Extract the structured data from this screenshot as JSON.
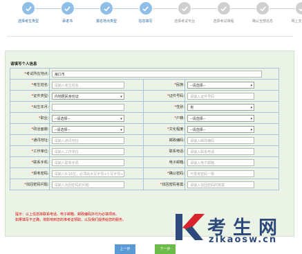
{
  "steps": [
    {
      "label": "选择考生类型",
      "state": "done"
    },
    {
      "label": "承诺书",
      "state": "done"
    },
    {
      "label": "报名地点类型",
      "state": "done"
    },
    {
      "label": "信息填写",
      "state": "done"
    },
    {
      "label": "选择考试专业",
      "state": "todo"
    },
    {
      "label": "选择考试课程",
      "state": "todo"
    },
    {
      "label": "确认全部信息",
      "state": "todo"
    },
    {
      "label": "网上支付费用",
      "state": "todo"
    }
  ],
  "form": {
    "title": "请填写个人信息",
    "exam_location": {
      "label": "*考试所在地点:",
      "value": "海口市"
    },
    "rows": [
      {
        "l1": "*考生姓名:",
        "t1": "input",
        "v1": "请输入考生姓名",
        "l2": "*民族:",
        "t2": "select",
        "v2": "--请选择--"
      },
      {
        "l1": "*证件类型:",
        "t1": "select",
        "v1": "内地居民身份证",
        "l2": "*证件号码:",
        "t2": "input",
        "v2": "请输入证件号码"
      },
      {
        "l1": "*出生年月:",
        "t1": "input",
        "v1": "",
        "l2": "*性别:",
        "t2": "select",
        "v2": "男"
      },
      {
        "l1": "*职业:",
        "t1": "select",
        "v1": "--请选择--",
        "l2": "*户籍:",
        "t2": "select",
        "v2": "--请选择--"
      },
      {
        "l1": "*政治面貌:",
        "t1": "select",
        "v1": "--请选择--",
        "l2": "*文化程度:",
        "t2": "select",
        "v2": "--请选择--"
      },
      {
        "l1": "*通讯地址:",
        "t1": "input",
        "v1": "请输入通讯地址",
        "l2": "邮政编码:",
        "t2": "input",
        "v2": "请输入邮政编码"
      },
      {
        "l1": "*工作单位:",
        "t1": "input",
        "v1": "请输入工作单位",
        "l2": "联系电话:",
        "t2": "input",
        "v2": "请输入联系电话"
      },
      {
        "l1": "*联系手机:",
        "t1": "input",
        "v1": "请输入联系手机",
        "l2": "电子邮箱:",
        "t2": "input",
        "v2": "请输入电子邮箱"
      },
      {
        "l1": "*报考密码:",
        "t1": "input",
        "v1": "请输入8-16位，必须由大写字母+小写字母+",
        "l2": "*确认密码:",
        "t2": "input",
        "v2": "与报考密码一致"
      },
      {
        "l1": "*找回密码问题:",
        "t1": "input",
        "v1": "请输入找回密码的问题",
        "l2": "*找回密码答案:",
        "t2": "input",
        "v2": "请输入找回密码的答案"
      }
    ],
    "tips": [
      "提示：以上信息除联系电话、电子邮箱、邮政编码外均为必填项目。",
      "如果填写不正确，将影响到您的准考证领取，以及我们提供给您的服务。"
    ]
  },
  "buttons": {
    "prev": "上一步",
    "next": "下一步"
  },
  "watermark": {
    "brand": "考生网",
    "url": "zikaosw.cn"
  },
  "colors": {
    "done": "#8fbfe6",
    "todo": "#cfcfcf",
    "panel": "#eaf3e6",
    "required": "#dd0000",
    "next": "#6dbb48",
    "prev": "#5b9bd5"
  }
}
